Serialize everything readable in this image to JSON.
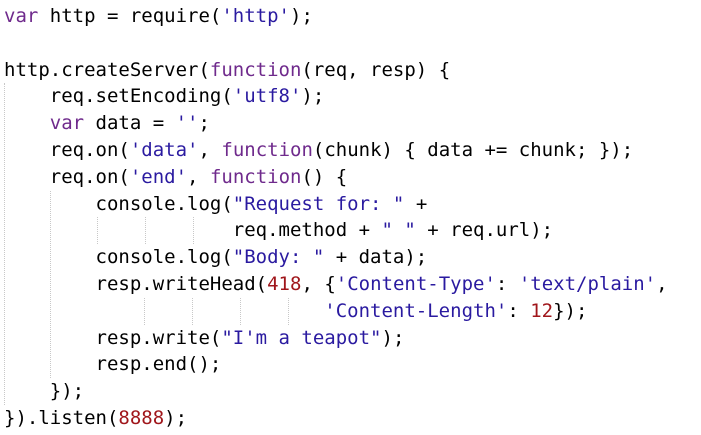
{
  "editor": {
    "language": "javascript",
    "colors": {
      "background": "#ffffff",
      "keyword": "#6f2a8c",
      "string": "#2a1aa0",
      "number": "#a0161b",
      "plain": "#000000",
      "indent_guide": "#c8c8c8"
    },
    "lines": [
      {
        "tokens": [
          {
            "t": "var",
            "k": "kw"
          },
          {
            "t": " http = require(",
            "k": "plain"
          },
          {
            "t": "'http'",
            "k": "str"
          },
          {
            "t": ");",
            "k": "plain"
          }
        ]
      },
      {
        "tokens": []
      },
      {
        "tokens": [
          {
            "t": "http.createServer(",
            "k": "plain"
          },
          {
            "t": "function",
            "k": "kw"
          },
          {
            "t": "(req, resp) {",
            "k": "plain"
          }
        ]
      },
      {
        "tokens": [
          {
            "t": "    req.setEncoding(",
            "k": "plain"
          },
          {
            "t": "'utf8'",
            "k": "str"
          },
          {
            "t": ");",
            "k": "plain"
          }
        ]
      },
      {
        "tokens": [
          {
            "t": "    ",
            "k": "plain"
          },
          {
            "t": "var",
            "k": "kw"
          },
          {
            "t": " data = ",
            "k": "plain"
          },
          {
            "t": "''",
            "k": "str"
          },
          {
            "t": ";",
            "k": "plain"
          }
        ]
      },
      {
        "tokens": [
          {
            "t": "    req.on(",
            "k": "plain"
          },
          {
            "t": "'data'",
            "k": "str"
          },
          {
            "t": ", ",
            "k": "plain"
          },
          {
            "t": "function",
            "k": "kw"
          },
          {
            "t": "(chunk) { data += chunk; });",
            "k": "plain"
          }
        ]
      },
      {
        "tokens": [
          {
            "t": "    req.on(",
            "k": "plain"
          },
          {
            "t": "'end'",
            "k": "str"
          },
          {
            "t": ", ",
            "k": "plain"
          },
          {
            "t": "function",
            "k": "kw"
          },
          {
            "t": "() {",
            "k": "plain"
          }
        ]
      },
      {
        "tokens": [
          {
            "t": "        console.log(",
            "k": "plain"
          },
          {
            "t": "\"Request for: \"",
            "k": "str"
          },
          {
            "t": " +",
            "k": "plain"
          }
        ]
      },
      {
        "tokens": [
          {
            "t": "                    req.method + ",
            "k": "plain"
          },
          {
            "t": "\" \"",
            "k": "str"
          },
          {
            "t": " + req.url);",
            "k": "plain"
          }
        ]
      },
      {
        "tokens": [
          {
            "t": "        console.log(",
            "k": "plain"
          },
          {
            "t": "\"Body: \"",
            "k": "str"
          },
          {
            "t": " + data);",
            "k": "plain"
          }
        ]
      },
      {
        "tokens": [
          {
            "t": "        resp.writeHead(",
            "k": "plain"
          },
          {
            "t": "418",
            "k": "num"
          },
          {
            "t": ", {",
            "k": "plain"
          },
          {
            "t": "'Content-Type'",
            "k": "str"
          },
          {
            "t": ": ",
            "k": "plain"
          },
          {
            "t": "'text/plain'",
            "k": "str"
          },
          {
            "t": ",",
            "k": "plain"
          }
        ]
      },
      {
        "tokens": [
          {
            "t": "                            ",
            "k": "plain"
          },
          {
            "t": "'Content-Length'",
            "k": "str"
          },
          {
            "t": ": ",
            "k": "plain"
          },
          {
            "t": "12",
            "k": "num"
          },
          {
            "t": "});",
            "k": "plain"
          }
        ]
      },
      {
        "tokens": [
          {
            "t": "        resp.write(",
            "k": "plain"
          },
          {
            "t": "\"I'm a teapot\"",
            "k": "str"
          },
          {
            "t": ");",
            "k": "plain"
          }
        ]
      },
      {
        "tokens": [
          {
            "t": "        resp.end();",
            "k": "plain"
          }
        ]
      },
      {
        "tokens": [
          {
            "t": "    });",
            "k": "plain"
          }
        ]
      },
      {
        "tokens": [
          {
            "t": "}).listen(",
            "k": "plain"
          },
          {
            "t": "8888",
            "k": "num"
          },
          {
            "t": ");",
            "k": "plain"
          }
        ]
      }
    ]
  }
}
